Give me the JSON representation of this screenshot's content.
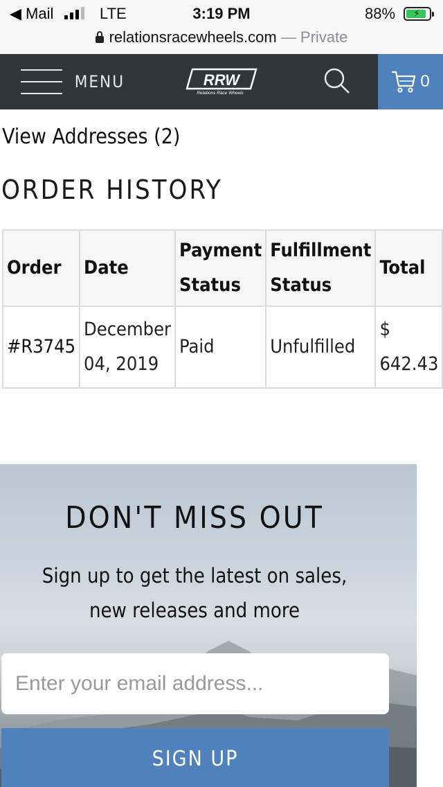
{
  "status_bar": {
    "back_app": "Mail",
    "network": "LTE",
    "time": "3:19 PM",
    "battery_percent": "88%",
    "battery_level": 0.88,
    "signal_bars_filled": 3
  },
  "url_bar": {
    "host": "relationsracewheels.com",
    "privacy": "— Private"
  },
  "header": {
    "menu_label": "MENU",
    "logo_text": "RRW",
    "logo_subtext": "Relations Race Wheels",
    "cart_count": "0",
    "colors": {
      "bar": "#32363b",
      "accent": "#4f81bd"
    }
  },
  "account": {
    "view_addresses": "View Addresses (2)",
    "order_history_title": "ORDER HISTORY",
    "orders_table": {
      "headers": {
        "order": "Order",
        "date": "Date",
        "payment_status_line1": "Payment",
        "payment_status_line2": "Status",
        "fulfillment_status_line1": "Fulfillment",
        "fulfillment_status_line2": "Status",
        "total": "Total"
      },
      "rows": [
        {
          "order": "#R3745",
          "date_line1": "December",
          "date_line2": "04, 2019",
          "payment_status": "Paid",
          "fulfillment_status": "Unfulfilled",
          "total_symbol": "$",
          "total_value": "642.43"
        }
      ]
    }
  },
  "newsletter": {
    "title": "DON'T MISS OUT",
    "text": "Sign up to get the latest on sales, new releases and more",
    "email_placeholder": "Enter your email address...",
    "button_label": "SIGN UP"
  }
}
